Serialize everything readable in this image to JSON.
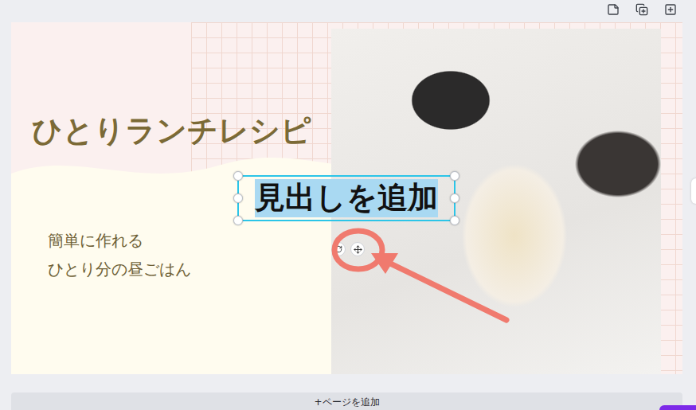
{
  "design": {
    "title": "ひとりランチレシピ",
    "subtitle": [
      "簡単に作れる",
      "ひとり分の昼ごはん"
    ],
    "heading": {
      "text": "見出しを追加",
      "selected": true
    }
  },
  "add_page": {
    "label": "+ページを追加"
  }
}
